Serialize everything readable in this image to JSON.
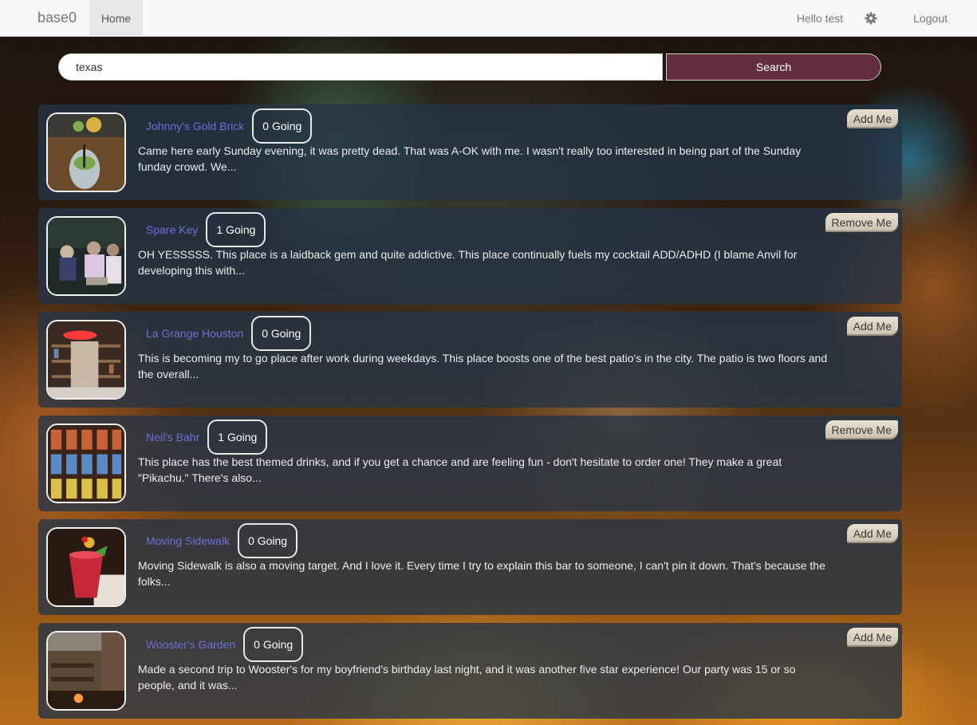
{
  "navbar": {
    "brand": "base0",
    "home": "Home",
    "hello": "Hello test",
    "settings_icon": "gear-icon",
    "logout": "Logout"
  },
  "search": {
    "value": "texas",
    "button": "Search"
  },
  "colors": {
    "search_button": "#632f3e",
    "venue_name": "#6f6fd8",
    "card_bg": "rgba(38,52,70,0.80)",
    "navbar_bg": "#f8f8f8"
  },
  "venues": [
    {
      "name": "Johnny's Gold Brick",
      "going": "0 Going",
      "action": "Add Me",
      "description": "Came here early Sunday evening, it was pretty dead. That was A-OK with me. I wasn't really too interested in being part of the Sunday funday crowd. We...",
      "photo_icon": "cocktail-photo"
    },
    {
      "name": "Spare Key",
      "going": "1 Going",
      "action": "Remove Me",
      "description": "OH YESSSSS. This place is a laidback gem and quite addictive. This place continually fuels my cocktail ADD/ADHD (I blame Anvil for developing this with...",
      "photo_icon": "patrons-photo"
    },
    {
      "name": "La Grange Houston",
      "going": "0 Going",
      "action": "Add Me",
      "description": "This is becoming my to go place after work during weekdays. This place boosts one of the best patio's in the city. The patio is two floors and the overall...",
      "photo_icon": "bar-shelf-photo"
    },
    {
      "name": "Neil's Bahr",
      "going": "1 Going",
      "action": "Remove Me",
      "description": "This place has the best themed drinks, and if you get a chance and are feeling fun - don't hesitate to order one! They make a great \"Pikachu.\" There's also...",
      "photo_icon": "games-shelf-photo"
    },
    {
      "name": "Moving Sidewalk",
      "going": "0 Going",
      "action": "Add Me",
      "description": "Moving Sidewalk is also a moving target. And I love it. Every time I try to explain this bar to someone, I can't pin it down. That's because the folks...",
      "photo_icon": "red-cocktail-photo"
    },
    {
      "name": "Wooster's Garden",
      "going": "0 Going",
      "action": "Add Me",
      "description": "Made a second trip to Wooster's for my boyfriend's birthday last night, and it was another five star experience! Our party was 15 or so people, and it was...",
      "photo_icon": "patio-photo"
    }
  ]
}
